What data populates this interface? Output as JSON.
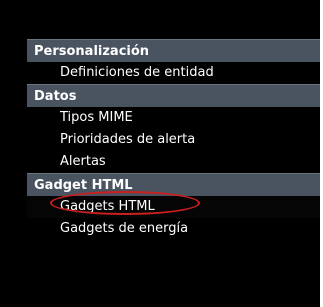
{
  "menu": {
    "sections": [
      {
        "label": "Personalización",
        "items": [
          {
            "label": "Definiciones de entidad"
          }
        ]
      },
      {
        "label": "Datos",
        "items": [
          {
            "label": "Tipos MIME"
          },
          {
            "label": "Prioridades de alerta"
          },
          {
            "label": "Alertas"
          }
        ]
      },
      {
        "label": "Gadget HTML",
        "items": [
          {
            "label": "Gadgets HTML",
            "highlighted": true
          },
          {
            "label": "Gadgets de energía"
          }
        ]
      }
    ]
  },
  "colors": {
    "background": "#000000",
    "section_header": "#4a5360",
    "text": "#ffffff",
    "highlight_ring": "#cc1f1f"
  }
}
